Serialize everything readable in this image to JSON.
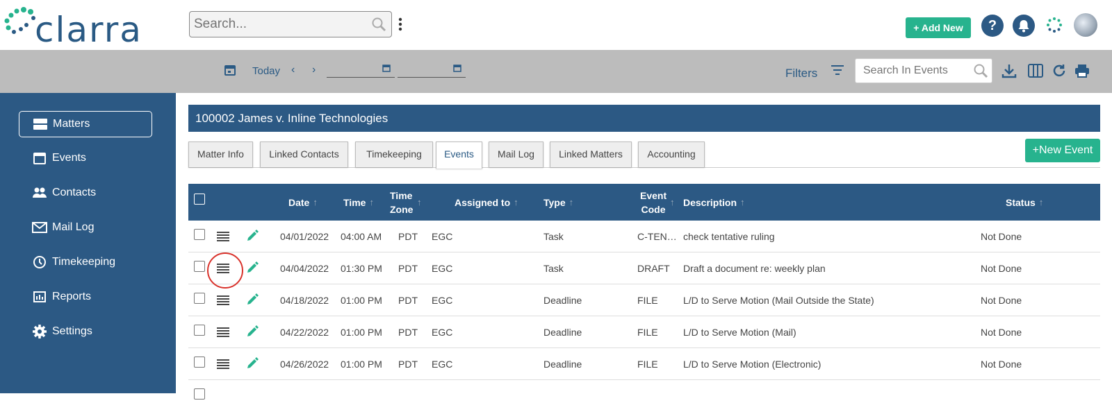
{
  "app": {
    "logo_text": "clarra"
  },
  "header": {
    "search_placeholder": "Search...",
    "add_new_label": "+ Add New",
    "help_label": "?"
  },
  "toolbar": {
    "today_label": "Today",
    "filters_label": "Filters",
    "search_events_placeholder": "Search In Events"
  },
  "sidebar": {
    "items": [
      {
        "label": "Matters",
        "icon": "matters-icon",
        "active": true
      },
      {
        "label": "Events",
        "icon": "calendar-icon"
      },
      {
        "label": "Contacts",
        "icon": "contacts-icon"
      },
      {
        "label": "Mail Log",
        "icon": "mail-icon"
      },
      {
        "label": "Timekeeping",
        "icon": "clock-icon"
      },
      {
        "label": "Reports",
        "icon": "reports-icon"
      },
      {
        "label": "Settings",
        "icon": "gear-icon"
      }
    ]
  },
  "matter": {
    "title": "100002 James v. Inline Technologies"
  },
  "tabs": [
    {
      "label": "Matter Info"
    },
    {
      "label": "Linked Contacts"
    },
    {
      "label": "Timekeeping"
    },
    {
      "label": "Events",
      "active": true
    },
    {
      "label": "Mail Log"
    },
    {
      "label": "Linked Matters"
    },
    {
      "label": "Accounting"
    }
  ],
  "new_event_label": "+New Event",
  "table": {
    "headers": {
      "date": "Date",
      "time": "Time",
      "time_zone": "Time Zone",
      "assigned_to": "Assigned to",
      "type": "Type",
      "event_code": "Event Code",
      "description": "Description",
      "status": "Status"
    },
    "rows": [
      {
        "date": "04/01/2022",
        "time": "04:00 AM",
        "tz": "PDT",
        "assigned": "EGC",
        "type": "Task",
        "code": "C-TENT...",
        "description": "check tentative ruling",
        "status": "Not Done"
      },
      {
        "date": "04/04/2022",
        "time": "01:30 PM",
        "tz": "PDT",
        "assigned": "EGC",
        "type": "Task",
        "code": "DRAFT",
        "description": "Draft a document re: weekly plan",
        "status": "Not Done"
      },
      {
        "date": "04/18/2022",
        "time": "01:00 PM",
        "tz": "PDT",
        "assigned": "EGC",
        "type": "Deadline",
        "code": "FILE",
        "description": "L/D to Serve Motion (Mail Outside the State)",
        "status": "Not Done"
      },
      {
        "date": "04/22/2022",
        "time": "01:00 PM",
        "tz": "PDT",
        "assigned": "EGC",
        "type": "Deadline",
        "code": "FILE",
        "description": "L/D to Serve Motion (Mail)",
        "status": "Not Done"
      },
      {
        "date": "04/26/2022",
        "time": "01:00 PM",
        "tz": "PDT",
        "assigned": "EGC",
        "type": "Deadline",
        "code": "FILE",
        "description": "L/D to Serve Motion (Electronic)",
        "status": "Not Done"
      }
    ]
  },
  "colors": {
    "brand_blue": "#2c5984",
    "accent_green": "#27b38e",
    "highlight_red": "#d9322b"
  }
}
